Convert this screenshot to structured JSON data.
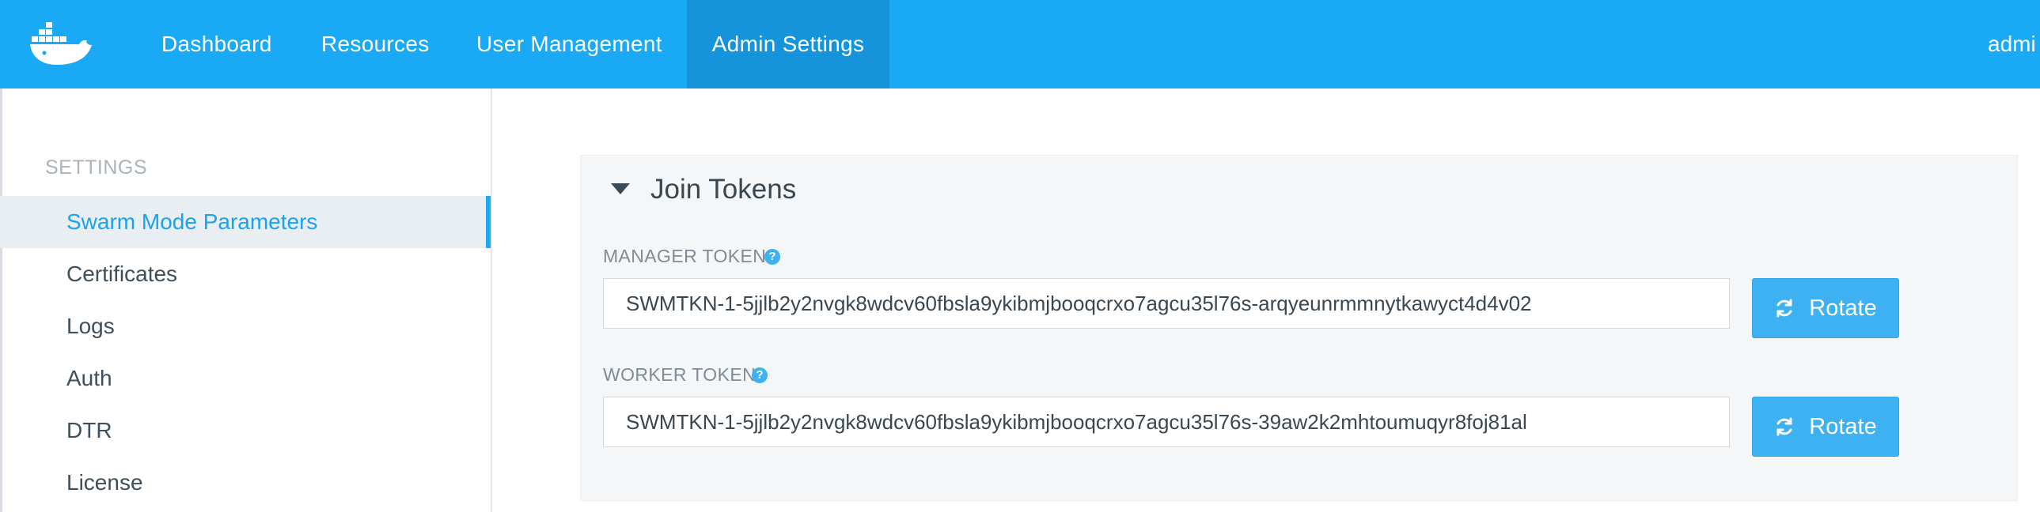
{
  "nav": {
    "items": [
      {
        "label": "Dashboard"
      },
      {
        "label": "Resources"
      },
      {
        "label": "User Management"
      },
      {
        "label": "Admin Settings",
        "active": true
      }
    ],
    "user_label": "admi"
  },
  "sidebar": {
    "heading": "SETTINGS",
    "items": [
      {
        "label": "Swarm Mode Parameters",
        "active": true
      },
      {
        "label": "Certificates"
      },
      {
        "label": "Logs"
      },
      {
        "label": "Auth"
      },
      {
        "label": "DTR"
      },
      {
        "label": "License"
      }
    ]
  },
  "panel": {
    "title": "Join Tokens",
    "manager": {
      "label": "MANAGER TOKEN",
      "value": "SWMTKN-1-5jjlb2y2nvgk8wdcv60fbsla9ykibmjbooqcrxo7agcu35l76s-arqyeunrmmnytkawyct4d4v02",
      "button_label": "Rotate"
    },
    "worker": {
      "label": "WORKER TOKEN",
      "value": "SWMTKN-1-5jjlb2y2nvgk8wdcv60fbsla9ykibmjbooqcrxo7agcu35l76s-39aw2k2mhtoumuqyr8foj81al",
      "button_label": "Rotate"
    }
  },
  "icons": {
    "logo": "docker-whale-icon",
    "caret": "caret-down-icon",
    "help": "question-circle-icon",
    "rotate": "refresh-icon"
  },
  "colors": {
    "brand": "#1aa9f5",
    "active_nav": "#1594dc",
    "button": "#3db1f2",
    "sidebar_active_text": "#1aa2ed"
  }
}
